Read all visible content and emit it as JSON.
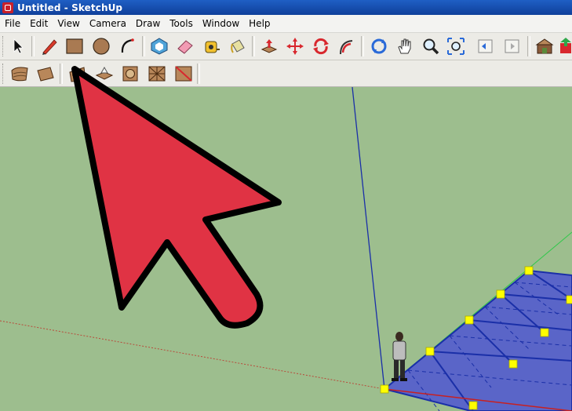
{
  "window": {
    "title": "Untitled - SketchUp"
  },
  "menubar": {
    "items": [
      "File",
      "Edit",
      "View",
      "Camera",
      "Draw",
      "Tools",
      "Window",
      "Help"
    ]
  },
  "toolbar_main": {
    "tools": [
      {
        "name": "select",
        "icon": "select-arrow-icon"
      },
      {
        "name": "pencil-line",
        "icon": "pencil-icon"
      },
      {
        "name": "rectangle",
        "icon": "rectangle-icon"
      },
      {
        "name": "circle",
        "icon": "circle-icon"
      },
      {
        "name": "arc",
        "icon": "arc-icon"
      },
      {
        "name": "make-component",
        "icon": "component-icon"
      },
      {
        "name": "eraser",
        "icon": "eraser-icon"
      },
      {
        "name": "tape-measure",
        "icon": "tape-measure-icon"
      },
      {
        "name": "paint-bucket",
        "icon": "paint-bucket-icon"
      },
      {
        "name": "push-pull",
        "icon": "push-pull-icon"
      },
      {
        "name": "move",
        "icon": "move-icon"
      },
      {
        "name": "rotate",
        "icon": "rotate-icon"
      },
      {
        "name": "follow-me",
        "icon": "follow-me-icon"
      },
      {
        "name": "orbit",
        "icon": "orbit-icon"
      },
      {
        "name": "pan",
        "icon": "pan-hand-icon"
      },
      {
        "name": "zoom",
        "icon": "zoom-icon"
      },
      {
        "name": "zoom-extents",
        "icon": "zoom-extents-icon"
      },
      {
        "name": "previous-view",
        "icon": "previous-view-icon"
      },
      {
        "name": "next-view",
        "icon": "next-view-icon"
      },
      {
        "name": "warehouse",
        "icon": "warehouse-icon"
      },
      {
        "name": "share-model",
        "icon": "share-model-icon"
      }
    ]
  },
  "toolbar_sandbox": {
    "tools": [
      {
        "name": "sandbox-from-contours",
        "icon": "sandbox-contours-icon"
      },
      {
        "name": "sandbox-from-scratch",
        "icon": "sandbox-scratch-icon"
      },
      {
        "name": "smoove",
        "icon": "smoove-icon"
      },
      {
        "name": "stamp",
        "icon": "stamp-icon"
      },
      {
        "name": "drape",
        "icon": "drape-icon"
      },
      {
        "name": "add-detail",
        "icon": "add-detail-icon"
      },
      {
        "name": "flip-edge",
        "icon": "flip-edge-icon"
      }
    ]
  },
  "colors": {
    "viewport_background": "#9dbe8e",
    "callout_arrow_fill": "#e03344",
    "grid_fill": "#5a65c8",
    "vertex_marker": "#ffff00",
    "axis_blue": "#1a2fa8",
    "axis_green": "#2fc84a",
    "axis_red": "#c82020"
  }
}
